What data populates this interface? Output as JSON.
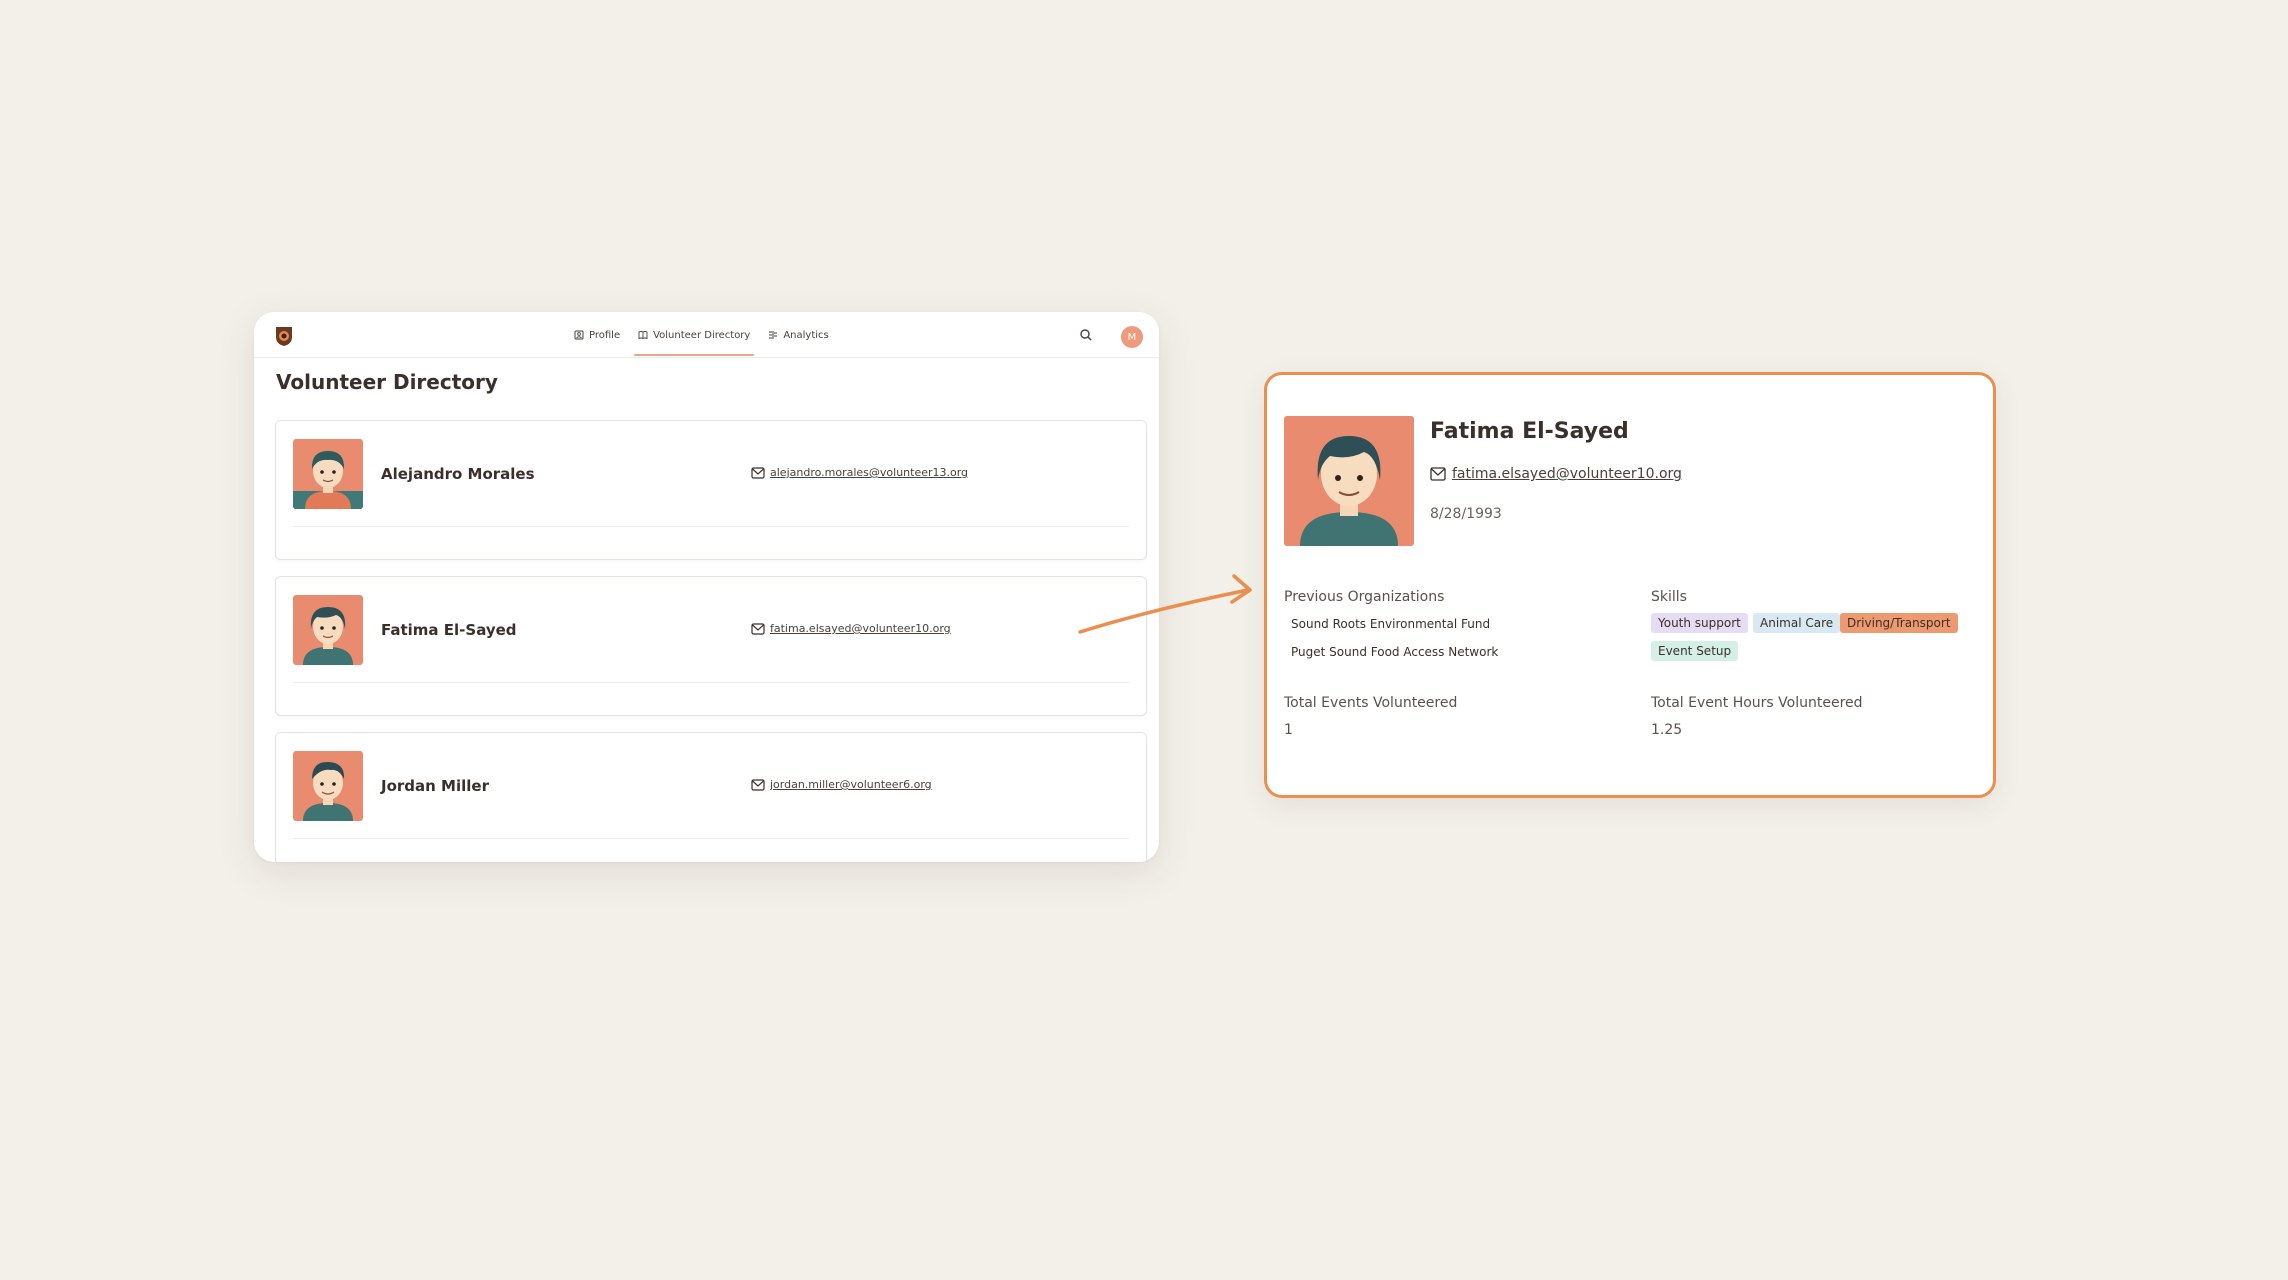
{
  "nav": {
    "tabs": [
      {
        "label": "Profile",
        "icon": "profile-icon",
        "active": false
      },
      {
        "label": "Volunteer Directory",
        "icon": "book-icon",
        "active": true
      },
      {
        "label": "Analytics",
        "icon": "analytics-icon",
        "active": false
      }
    ],
    "avatar_initial": "M",
    "accent": "#e8a787"
  },
  "directory": {
    "title": "Volunteer Directory",
    "volunteers": [
      {
        "name": "Alejandro Morales",
        "email": "alejandro.morales@volunteer13.org"
      },
      {
        "name": "Fatima El-Sayed",
        "email": "fatima.elsayed@volunteer10.org"
      },
      {
        "name": "Jordan Miller",
        "email": "jordan.miller@volunteer6.org"
      }
    ]
  },
  "detail": {
    "name": "Fatima El-Sayed",
    "email": "fatima.elsayed@volunteer10.org",
    "dob": "8/28/1993",
    "prev_orgs_label": "Previous Organizations",
    "prev_orgs": [
      "Sound Roots Environmental Fund",
      "Puget Sound Food Access Network"
    ],
    "skills_label": "Skills",
    "skills": [
      {
        "label": "Youth support",
        "color": "#e6dcf3"
      },
      {
        "label": "Animal Care",
        "color": "#d9e9f3"
      },
      {
        "label": "Driving/Transport",
        "color": "#ee9a70"
      },
      {
        "label": "Event Setup",
        "color": "#d4f0e6"
      }
    ],
    "total_events_label": "Total Events Volunteered",
    "total_events": "1",
    "total_hours_label": "Total Event Hours Volunteered",
    "total_hours": "1.25",
    "border_color": "#ea8f4e"
  }
}
